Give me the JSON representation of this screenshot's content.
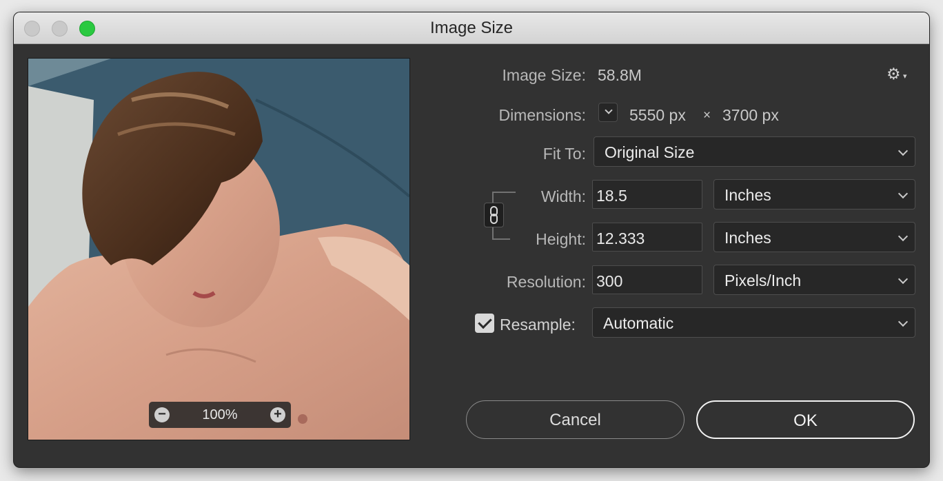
{
  "window": {
    "title": "Image Size"
  },
  "preview": {
    "zoom": "100%"
  },
  "info": {
    "image_size_label": "Image Size:",
    "image_size_value": "58.8M",
    "dimensions_label": "Dimensions:",
    "width_px": "5550 px",
    "times": "×",
    "height_px": "3700 px"
  },
  "fit_to": {
    "label": "Fit To:",
    "value": "Original Size"
  },
  "width": {
    "label": "Width:",
    "value": "18.5",
    "unit": "Inches"
  },
  "height": {
    "label": "Height:",
    "value": "12.333",
    "unit": "Inches"
  },
  "resolution": {
    "label": "Resolution:",
    "value": "300",
    "unit": "Pixels/Inch"
  },
  "resample": {
    "label": "Resample:",
    "value": "Automatic",
    "checked": true
  },
  "buttons": {
    "cancel": "Cancel",
    "ok": "OK"
  },
  "icons": {
    "settings": "gear-icon",
    "link": "link-icon",
    "zoom_out": "zoom-out-icon",
    "zoom_in": "zoom-in-icon"
  }
}
